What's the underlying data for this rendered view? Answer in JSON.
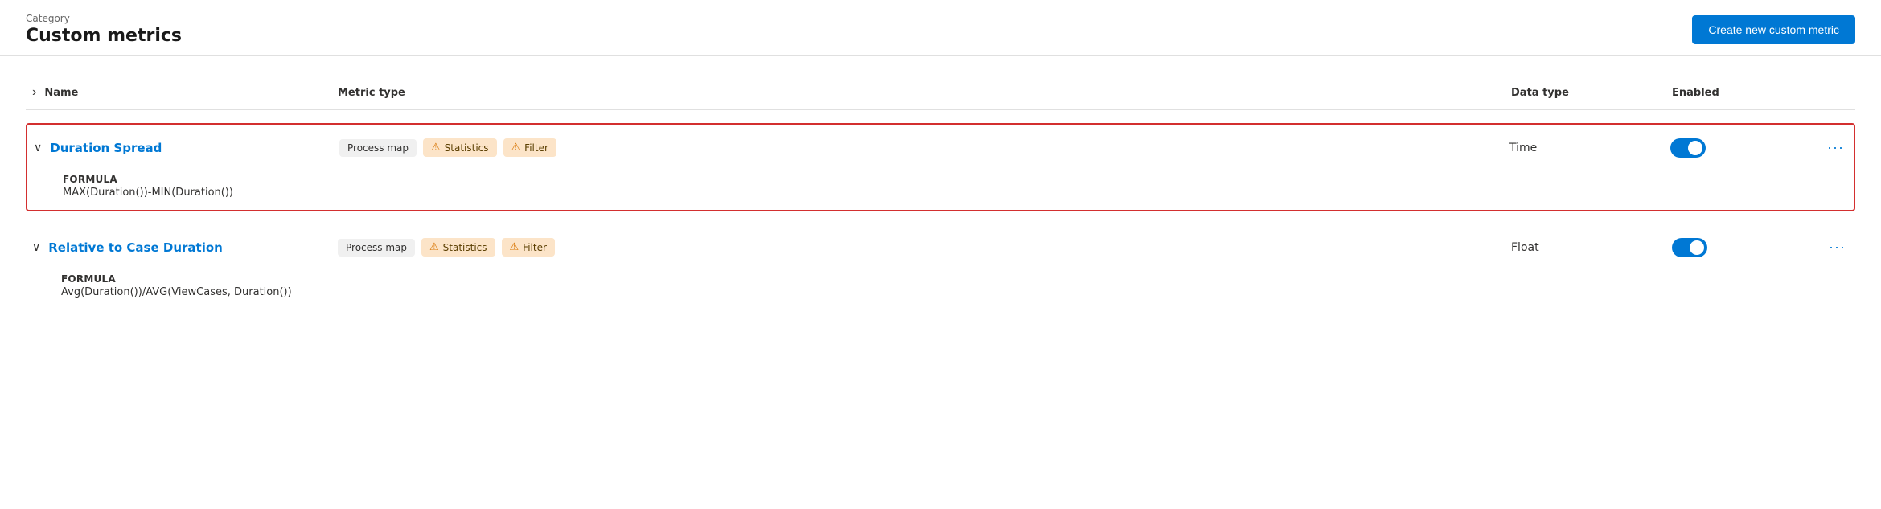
{
  "header": {
    "category_label": "Category",
    "page_title": "Custom metrics",
    "create_button_label": "Create new custom metric"
  },
  "table": {
    "expand_all_icon": "›",
    "columns": {
      "name": "Name",
      "metric_type": "Metric type",
      "data_type": "Data type",
      "enabled": "Enabled"
    },
    "rows": [
      {
        "id": "duration-spread",
        "name": "Duration Spread",
        "expanded": true,
        "highlighted": true,
        "chevron": "∨",
        "formula_label": "FORMULA",
        "formula": "MAX(Duration())-MIN(Duration())",
        "metric_types": [
          {
            "label": "Process map",
            "type": "neutral"
          },
          {
            "label": "Statistics",
            "type": "warning"
          },
          {
            "label": "Filter",
            "type": "warning"
          }
        ],
        "data_type": "Time",
        "enabled": true
      },
      {
        "id": "relative-to-case",
        "name": "Relative to Case Duration",
        "expanded": true,
        "highlighted": false,
        "chevron": "∨",
        "formula_label": "FORMULA",
        "formula": "Avg(Duration())/AVG(ViewCases, Duration())",
        "metric_types": [
          {
            "label": "Process map",
            "type": "neutral"
          },
          {
            "label": "Statistics",
            "type": "warning"
          },
          {
            "label": "Filter",
            "type": "warning"
          }
        ],
        "data_type": "Float",
        "enabled": true
      }
    ]
  },
  "icons": {
    "warning": "⚠",
    "more": "···",
    "chevron_right": "›",
    "chevron_down": "∨"
  }
}
